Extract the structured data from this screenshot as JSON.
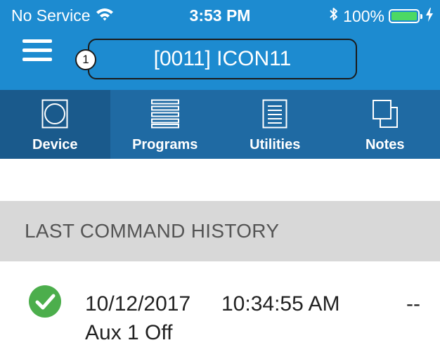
{
  "status_bar": {
    "carrier": "No Service",
    "time": "3:53 PM",
    "battery_percent": "100%",
    "battery_color": "#4cd964",
    "icons": [
      "wifi-icon",
      "bluetooth-icon",
      "battery-icon",
      "charging-icon"
    ]
  },
  "nav": {
    "menu_icon": "hamburger-menu-icon",
    "callout_number": "1",
    "device_title": "[0011] ICON11"
  },
  "tabs": [
    {
      "label": "Device",
      "icon": "device-icon",
      "active": true
    },
    {
      "label": "Programs",
      "icon": "programs-icon",
      "active": false
    },
    {
      "label": "Utilities",
      "icon": "utilities-icon",
      "active": false
    },
    {
      "label": "Notes",
      "icon": "notes-icon",
      "active": false
    }
  ],
  "history": {
    "header": "LAST COMMAND HISTORY",
    "entries": [
      {
        "status_icon": "check-circle-icon",
        "status_color": "#4cae4c",
        "date": "10/12/2017",
        "time": "10:34:55 AM",
        "extra": "--",
        "detail": "Aux 1 Off"
      }
    ]
  },
  "colors": {
    "primary": "#1d8bd0",
    "tab_bar": "#1f6aa3",
    "tab_active": "#1a5a8c",
    "section_header_bg": "#d8d8d8"
  }
}
